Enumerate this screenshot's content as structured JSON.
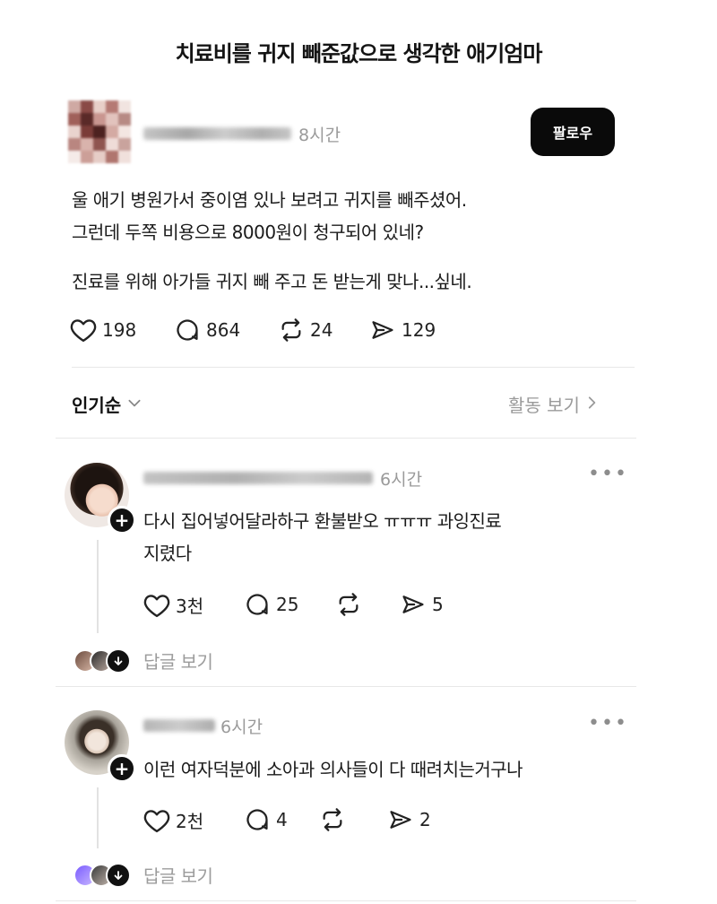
{
  "headline": "치료비를 귀지 빼준값으로 생각한 애기엄마",
  "post": {
    "time": "8시간",
    "follow_label": "팔로우",
    "lines": [
      "울 애기 병원가서 중이염 있나 보려고 귀지를 빼주셨어.",
      "그런데 두쪽 비용으로 8000원이 청구되어 있네?",
      "진료를 위해 아가들 귀지 빼 주고 돈 받는게 맞나...싶네."
    ],
    "stats": {
      "likes": "198",
      "comments": "864",
      "reposts": "24",
      "shares": "129"
    }
  },
  "sort": {
    "label": "인기순",
    "activity_label": "활동 보기"
  },
  "comments": [
    {
      "time": "6시간",
      "lines": [
        "다시 집어넣어달라하구 환불받오 ㅠㅠㅠ 과잉진료",
        "지렸다"
      ],
      "stats": {
        "likes": "3천",
        "comments": "25",
        "reposts": "",
        "shares": "5"
      },
      "reply_label": "답글 보기"
    },
    {
      "time": "6시간",
      "lines": [
        "이런 여자덕분에 소아과 의사들이 다 때려치는거구나"
      ],
      "stats": {
        "likes": "2천",
        "comments": "4",
        "reposts": "",
        "shares": "2"
      },
      "reply_label": "답글 보기"
    }
  ],
  "colors": {
    "follow_button_bg": "#0a0a0a",
    "muted_text": "#9a9a9a",
    "divider": "#e8e8e8"
  },
  "icons": {
    "like": "heart-icon",
    "comment": "speech-bubble-icon",
    "repost": "repost-arrows-icon",
    "share": "send-icon",
    "sort": "chevron-down-icon",
    "activity": "chevron-right-icon",
    "more": "more-dots-icon",
    "follow_badge": "plus-icon",
    "reply_badge": "arrow-down-icon"
  }
}
